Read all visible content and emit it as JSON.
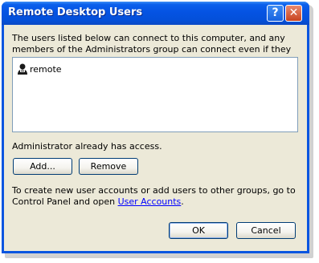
{
  "window": {
    "title": "Remote Desktop Users"
  },
  "titlebar_buttons": {
    "help": "?",
    "close": "✕"
  },
  "description": "The users listed below can connect to this computer, and any members of the Administrators group can connect even if they are not listed.",
  "users": [
    {
      "name": "remote",
      "icon": "user-icon"
    }
  ],
  "access_note": "Administrator already has access.",
  "buttons": {
    "add": "Add...",
    "remove": "Remove",
    "ok": "OK",
    "cancel": "Cancel"
  },
  "info": {
    "prefix": "To create new user accounts or add users to other groups, go to Control Panel and open ",
    "link": "User Accounts",
    "suffix": "."
  }
}
